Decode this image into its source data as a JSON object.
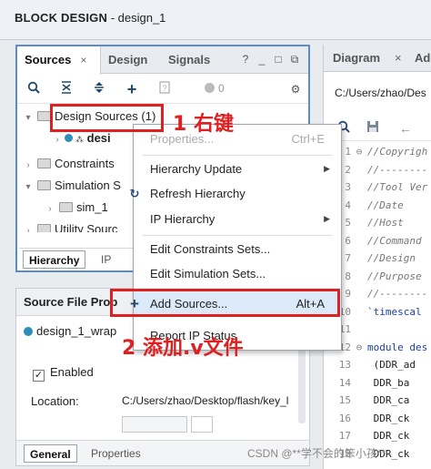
{
  "window": {
    "title_bold": "BLOCK DESIGN",
    "title_rest": " - design_1"
  },
  "sources": {
    "tabs": [
      {
        "label": "Sources",
        "close": "×"
      },
      {
        "label": "Design"
      },
      {
        "label": "Signals"
      }
    ],
    "tab_icons": [
      "?",
      "_",
      "□",
      "⧉"
    ],
    "toolbar_count": "0",
    "tree": [
      {
        "label": "Design Sources (1)",
        "level": 0,
        "expanded": true
      },
      {
        "label": "desi",
        "level": 1,
        "bold": true
      },
      {
        "label": "Constraints",
        "level": 0
      },
      {
        "label": "Simulation S",
        "level": 0,
        "expanded": true
      },
      {
        "label": "sim_1",
        "level": 1
      },
      {
        "label": "Utility Sourc",
        "level": 0
      }
    ],
    "bottom_tabs": [
      "Hierarchy",
      "IP"
    ]
  },
  "file_props": {
    "title": "Source File Prop",
    "file": "design_1_wrap",
    "enabled_label": "Enabled",
    "location_label": "Location:",
    "location_value": "C:/Users/zhao/Desktop/flash/key_l",
    "bottom_tabs": [
      "General",
      "Properties"
    ]
  },
  "diagram": {
    "tabs": [
      "Diagram",
      "Add"
    ],
    "path": "C:/Users/zhao/Des",
    "code_lines": [
      {
        "n": "1",
        "t": "//Copyrigh"
      },
      {
        "n": "2",
        "t": "//--------"
      },
      {
        "n": "3",
        "t": "//Tool Ver"
      },
      {
        "n": "4",
        "t": "//Date"
      },
      {
        "n": "5",
        "t": "//Host"
      },
      {
        "n": "6",
        "t": "//Command"
      },
      {
        "n": "7",
        "t": "//Design"
      },
      {
        "n": "8",
        "t": "//Purpose"
      },
      {
        "n": "9",
        "t": "//--------"
      },
      {
        "n": "10",
        "t": "`timescal"
      },
      {
        "n": "11",
        "t": ""
      },
      {
        "n": "12",
        "t": "module des"
      },
      {
        "n": "13",
        "t": "  (DDR_ad"
      },
      {
        "n": "14",
        "t": "   DDR_ba"
      },
      {
        "n": "15",
        "t": "   DDR_ca"
      },
      {
        "n": "16",
        "t": "   DDR_ck"
      },
      {
        "n": "17",
        "t": "   DDR_ck"
      },
      {
        "n": "18",
        "t": "   DDR_ck"
      }
    ]
  },
  "context_menu": {
    "items": [
      {
        "label": "Properties...",
        "shortcut": "Ctrl+E",
        "disabled": true
      },
      {
        "label": "Hierarchy Update",
        "submenu": true
      },
      {
        "label": "Refresh Hierarchy",
        "icon": "↻"
      },
      {
        "label": "IP Hierarchy",
        "submenu": true
      },
      {
        "label": "Edit Constraints Sets..."
      },
      {
        "label": "Edit Simulation Sets..."
      },
      {
        "label": "Add Sources...",
        "shortcut": "Alt+A",
        "icon": "+"
      },
      {
        "label": "Report IP Status"
      }
    ]
  },
  "annotations": {
    "step1": "1 右键",
    "step2": "2 添加.v文件",
    "color": "#e02020"
  },
  "watermark": "CSDN @**学不会的笨小孩**"
}
